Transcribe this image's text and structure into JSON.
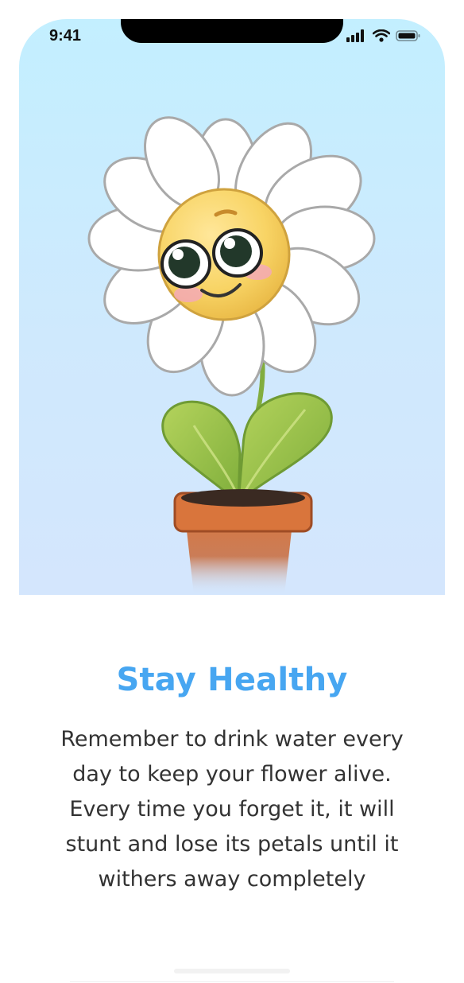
{
  "status_bar": {
    "time": "9:41"
  },
  "onboarding": {
    "title": "Stay Healthy",
    "description": "Remember to drink water every day to keep your flower alive. Every time you forget it, it will stunt and lose its petals until it withers away completely"
  },
  "icons": {
    "signal": "signal-icon",
    "wifi": "wifi-icon",
    "battery": "battery-icon",
    "illustration": "flower-pot-illustration"
  },
  "colors": {
    "title": "#47a6f1",
    "hero_background_top": "#c3efff",
    "hero_background_bottom": "#d4e6fd",
    "text": "#333333"
  }
}
